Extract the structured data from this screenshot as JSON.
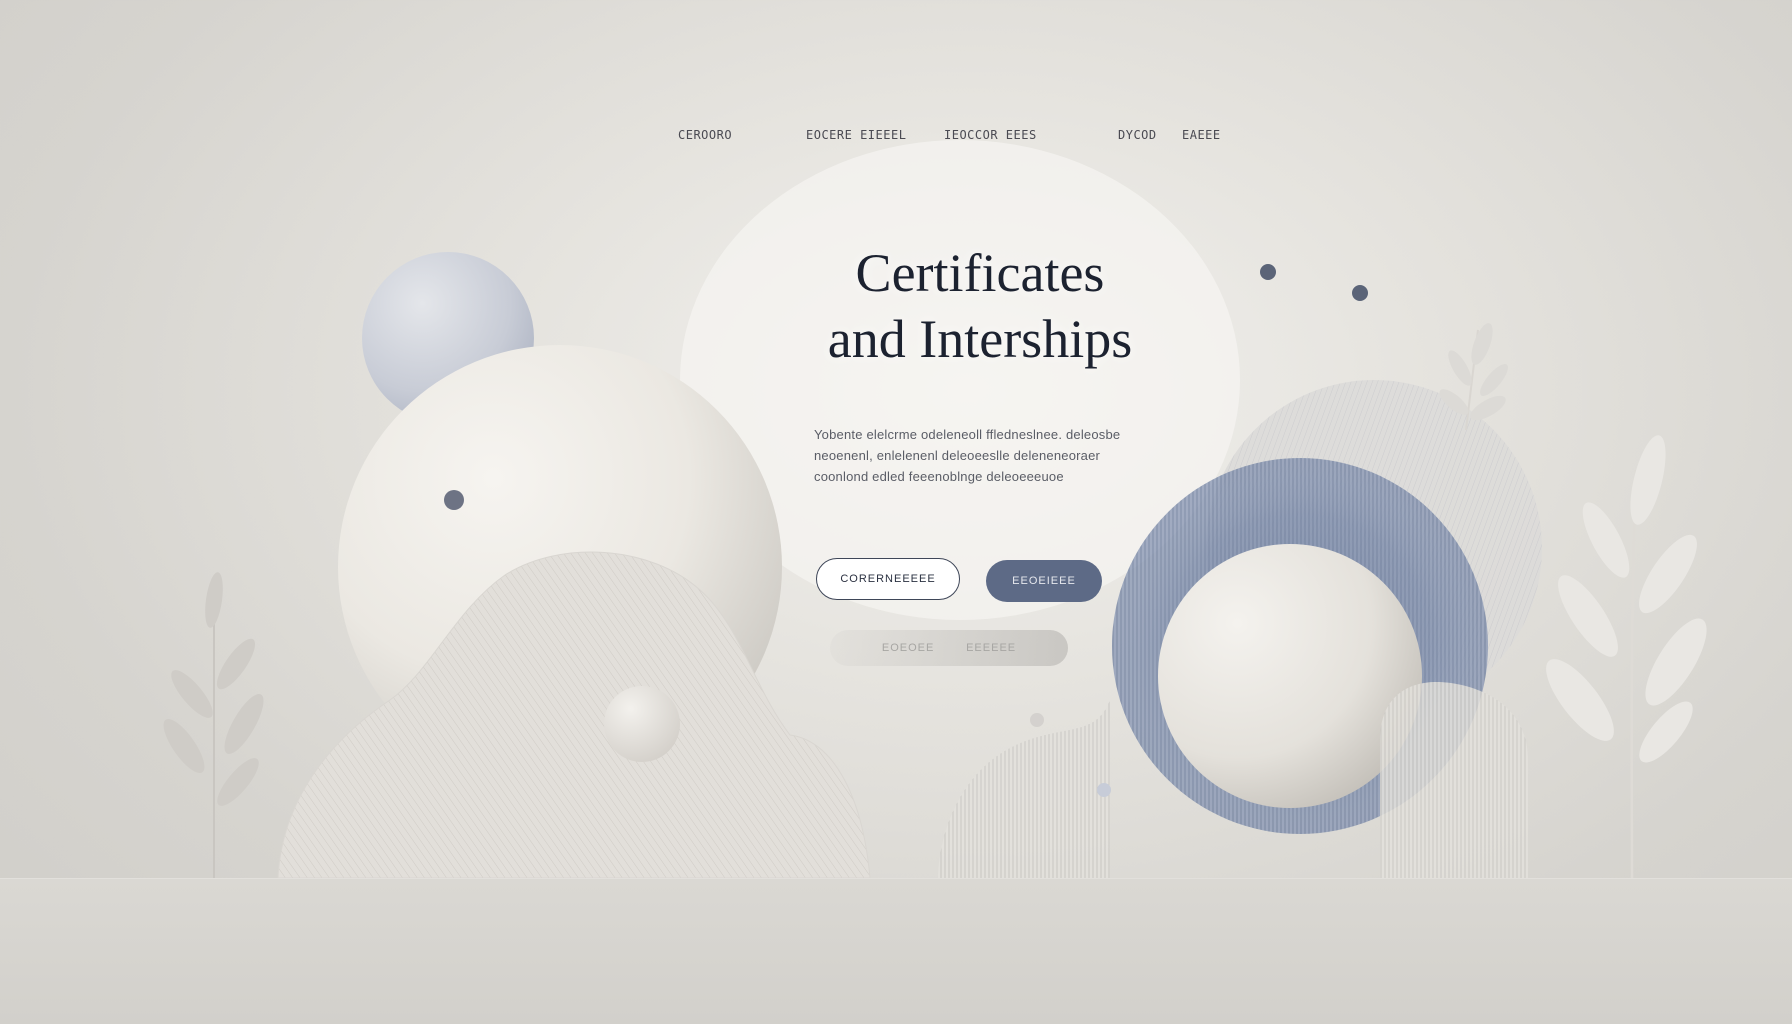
{
  "nav": {
    "items": [
      {
        "label": "CEROORO"
      },
      {
        "label": "EOCERE EIEEEL"
      },
      {
        "label": "IEOCCOR EEES"
      },
      {
        "label": "DYCOD"
      },
      {
        "label": "EAEEE"
      }
    ]
  },
  "hero": {
    "title_line1": "Certificates",
    "title_line2": "and Interships",
    "description": "Yobente elelcrme odeleneoll ffledneslnee. deleosbe neoenenl, enlelenenl deleoeeslle deleneneoraer coonlond edled feeenoblnge deleoeeeuoe"
  },
  "buttons": {
    "primary_label": "CORERNEEEEE",
    "secondary_label": "EEOEIEEE",
    "ghost_left_label": "EOEOEE",
    "ghost_right_label": "EEEEEE"
  },
  "colors": {
    "background": "#dcdad5",
    "accent_blue": "#5d6a86",
    "title_ink": "#1c2230"
  }
}
